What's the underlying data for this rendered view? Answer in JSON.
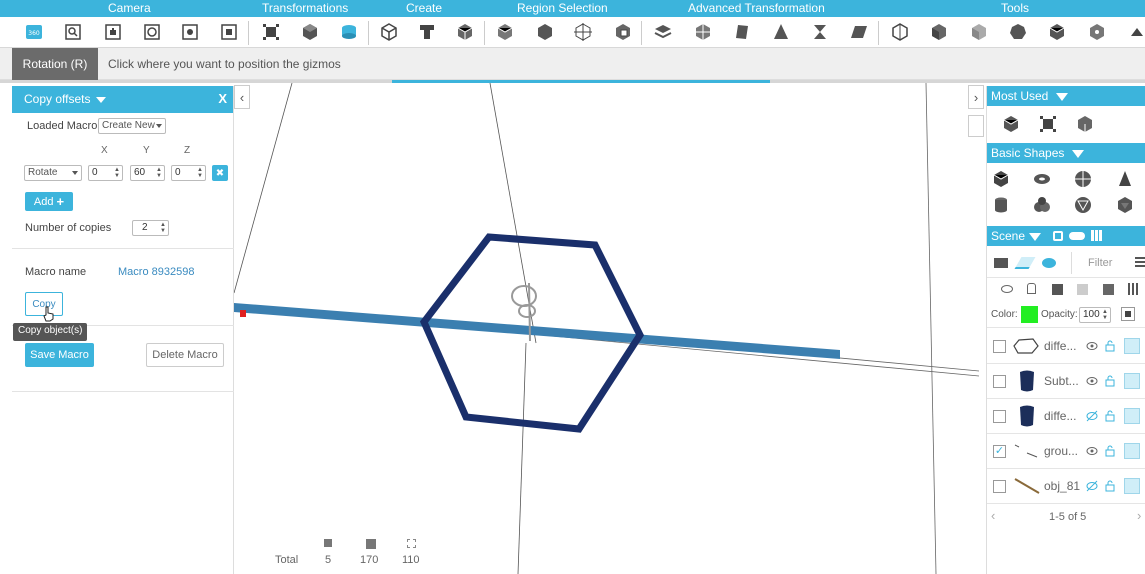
{
  "ribbon": {
    "groups": [
      "Camera",
      "Transformations",
      "Create",
      "Region Selection",
      "Advanced Transformation",
      "Tools"
    ]
  },
  "status": {
    "mode": "Rotation (R)",
    "hint": "Click where you want to position the gizmos",
    "progress_percent": 33
  },
  "left_panel": {
    "title": "Copy offsets",
    "close": "X",
    "loaded_macro_label": "Loaded Macro",
    "loaded_macro_value": "Create New",
    "axis_headers": [
      "X",
      "Y",
      "Z"
    ],
    "operation": "Rotate",
    "x_value": "0",
    "y_value": "60",
    "z_value": "0",
    "remove_icon": "✖",
    "add_label": "Add",
    "add_icon": "+",
    "copies_label": "Number of copies",
    "copies_value": "2",
    "macro_name_label": "Macro name",
    "macro_name_value": "Macro 8932598",
    "copy_label": "Copy",
    "tooltip": "Copy object(s)",
    "save_label": "Save Macro",
    "delete_label": "Delete Macro"
  },
  "viewport": {
    "left_toggle": "‹",
    "right_toggle": "›",
    "stats": {
      "total_label": "Total",
      "values": [
        "5",
        "170",
        "110"
      ]
    }
  },
  "right_panel": {
    "most_used": "Most Used",
    "basic_shapes": "Basic Shapes",
    "scene": "Scene",
    "filter_placeholder": "Filter",
    "color_label": "Color:",
    "color_value": "#22ee22",
    "opacity_label": "Opacity:",
    "opacity_value": "100",
    "pagination": "1-5 of 5",
    "prev": "‹",
    "next": "›",
    "objects": [
      {
        "name": "diffe...",
        "checked": false,
        "icon": "hexagon-outline-icon"
      },
      {
        "name": "Subt...",
        "checked": false,
        "icon": "dark-cylinder-icon"
      },
      {
        "name": "diffe...",
        "checked": false,
        "icon": "dark-cylinder-icon"
      },
      {
        "name": "grou...",
        "checked": true,
        "icon": "group-lines-icon"
      },
      {
        "name": "obj_81",
        "checked": false,
        "icon": "line-icon"
      }
    ]
  },
  "colors": {
    "accent": "#3cb4dc",
    "hexagon": "#1a2f6b",
    "bar": "#3b7fb0"
  }
}
